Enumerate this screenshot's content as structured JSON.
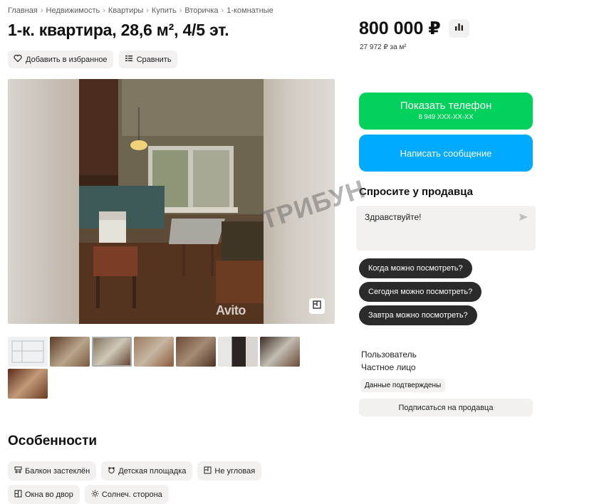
{
  "breadcrumbs": [
    "Главная",
    "Недвижимость",
    "Квартиры",
    "Купить",
    "Вторичка",
    "1-комнатные"
  ],
  "title": "1-к. квартира, 28,6 м², 4/5 эт.",
  "actions": {
    "favorite_label": "Добавить в избранное",
    "compare_label": "Сравнить"
  },
  "gallery": {
    "watermark_brand": "Avito",
    "thumbnail_count": 8
  },
  "price": {
    "value": "800 000 ₽",
    "per_m2": "27 972 ₽ за м²"
  },
  "contact": {
    "show_phone_label": "Показать телефон",
    "phone_masked": "8 949 XXX-XX-XX",
    "message_label": "Написать сообщение"
  },
  "ask": {
    "title": "Спросите у продавца",
    "input_value": "Здравствуйте!",
    "quick_replies": [
      "Когда можно посмотреть?",
      "Сегодня можно посмотреть?",
      "Завтра можно посмотреть?"
    ]
  },
  "seller": {
    "name": "Пользователь",
    "type": "Частное лицо",
    "badge": "Данные подтверждены",
    "subscribe_label": "Подписаться на продавца"
  },
  "features": {
    "title": "Особенности",
    "items": [
      {
        "label": "Балкон застеклён",
        "icon": "balcony-icon"
      },
      {
        "label": "Детская площадка",
        "icon": "playground-icon"
      },
      {
        "label": "Не угловая",
        "icon": "layout-icon"
      },
      {
        "label": "Окна во двор",
        "icon": "window-icon"
      },
      {
        "label": "Солнеч. сторона",
        "icon": "sun-icon"
      }
    ]
  },
  "overlay_watermark": "ТРИБУН",
  "colors": {
    "phone_button": "#02d15c",
    "message_button": "#00aaff",
    "chip_bg": "#f2f1f0",
    "quick_reply_bg": "#2b2b2b"
  }
}
